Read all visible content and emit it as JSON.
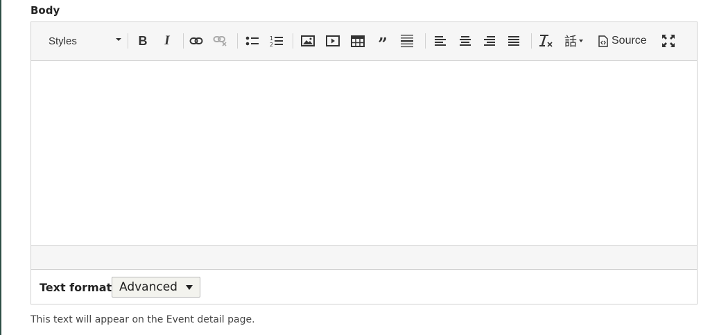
{
  "field": {
    "label": "Body",
    "description": "This text will appear on the Event detail page."
  },
  "toolbar": {
    "styles_label": "Styles",
    "source_label": "Source",
    "buttons": [
      {
        "name": "bold",
        "icon": "bold-icon"
      },
      {
        "name": "italic",
        "icon": "italic-icon"
      },
      {
        "name": "link",
        "icon": "link-icon"
      },
      {
        "name": "unlink",
        "icon": "unlink-icon"
      },
      {
        "name": "bulleted-list",
        "icon": "bulleted-list-icon"
      },
      {
        "name": "numbered-list",
        "icon": "numbered-list-icon"
      },
      {
        "name": "image",
        "icon": "image-icon"
      },
      {
        "name": "media-embed",
        "icon": "media-embed-icon"
      },
      {
        "name": "table",
        "icon": "table-icon"
      },
      {
        "name": "blockquote",
        "icon": "blockquote-icon"
      },
      {
        "name": "horizontal-line",
        "icon": "horizontal-line-icon"
      },
      {
        "name": "align-left",
        "icon": "align-left-icon"
      },
      {
        "name": "align-center",
        "icon": "align-center-icon"
      },
      {
        "name": "align-right",
        "icon": "align-right-icon"
      },
      {
        "name": "justify",
        "icon": "justify-icon"
      },
      {
        "name": "remove-format",
        "icon": "remove-format-icon"
      },
      {
        "name": "language",
        "icon": "language-icon"
      },
      {
        "name": "source",
        "icon": "source-icon"
      },
      {
        "name": "maximize",
        "icon": "maximize-icon"
      }
    ]
  },
  "editor": {
    "content": ""
  },
  "text_format": {
    "label": "Text format",
    "selected": "Advanced"
  }
}
